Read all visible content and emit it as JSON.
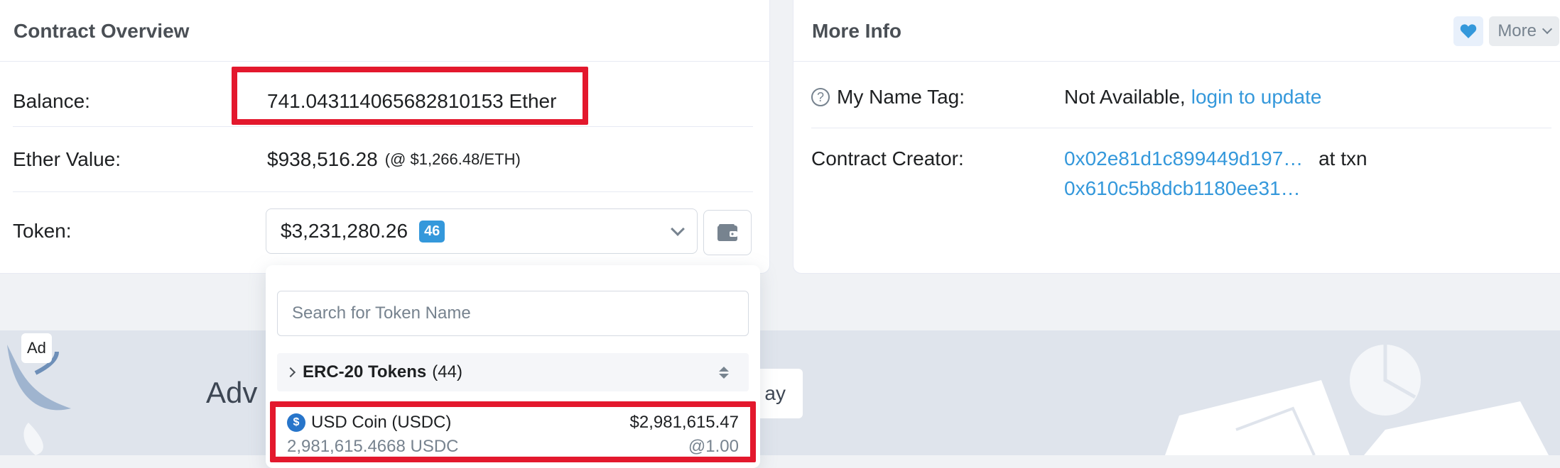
{
  "overview": {
    "title": "Contract Overview",
    "balance_label": "Balance:",
    "balance_value": "741.043114065682810153 Ether",
    "ether_value_label": "Ether Value:",
    "ether_value": "$938,516.28",
    "ether_rate": "(@ $1,266.48/ETH)",
    "token_label": "Token:",
    "token_total": "$3,231,280.26",
    "token_count": "46"
  },
  "more_info": {
    "title": "More Info",
    "more_label": "More",
    "name_tag_label": "My Name Tag:",
    "name_tag_value": "Not Available,",
    "name_tag_link": "login to update",
    "creator_label": "Contract Creator:",
    "creator_address": "0x02e81d1c899449d197…",
    "creator_at_txn": "at txn",
    "creator_txn": "0x610c5b8dcb1180ee31…"
  },
  "dropdown": {
    "search_placeholder": "Search for Token Name",
    "group_label": "ERC-20 Tokens",
    "group_count": "(44)",
    "items": [
      {
        "name": "USD Coin (USDC)",
        "value": "$2,981,615.47",
        "amount": "2,981,615.4668 USDC",
        "rate": "@1.00"
      }
    ]
  },
  "ad": {
    "badge": "Ad",
    "text_partial": "Adv",
    "button_partial": "ay"
  },
  "colors": {
    "link": "#3498db",
    "highlight": "#e3182d",
    "badge": "#3498db"
  }
}
